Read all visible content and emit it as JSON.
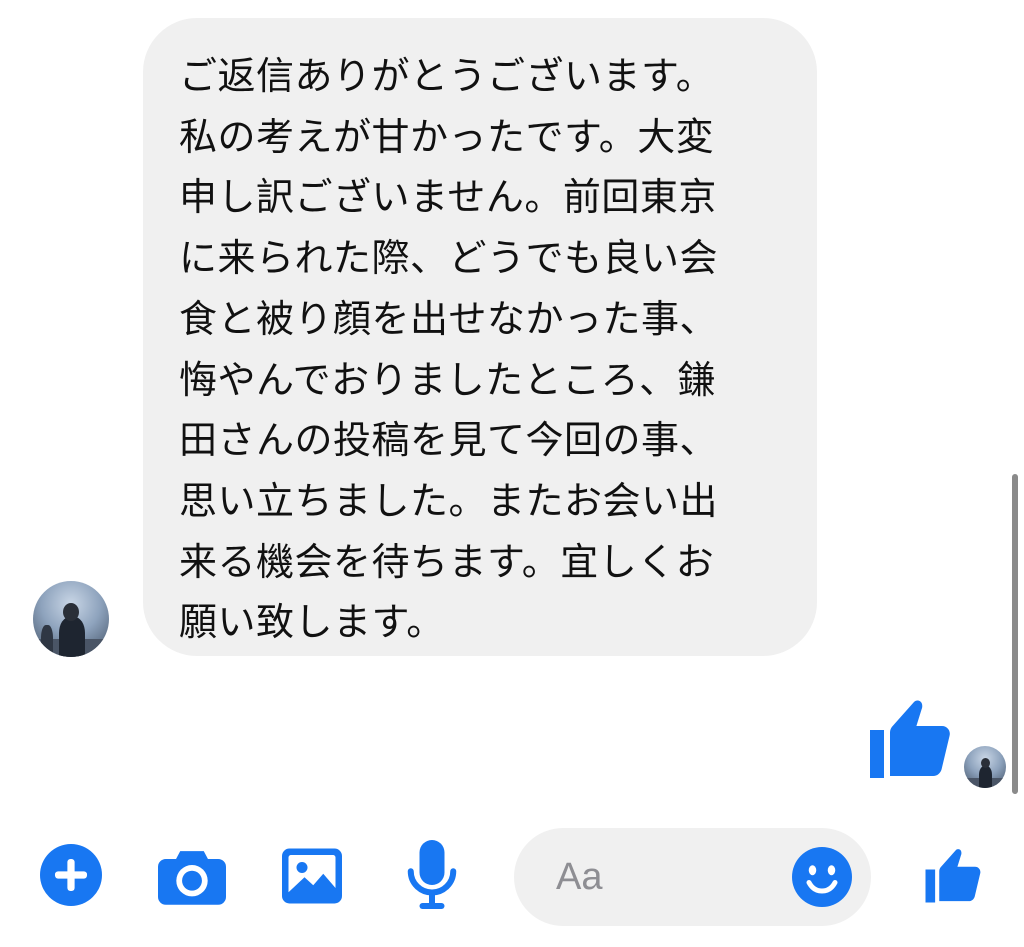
{
  "message": {
    "lines": [
      "ご返信ありがとうございます。",
      "私の考えが甘かったです。大変",
      "申し訳ございません。前回東京",
      "に来られた際、どうでも良い会",
      "食と被り顔を出せなかった事、",
      "悔やんでおりましたところ、鎌",
      "田さんの投稿を見て今回の事、",
      "思い立ちました。またお会い出",
      "来る機会を待ちます。宜しくお",
      "願い致します。"
    ]
  },
  "composer": {
    "placeholder": "Aa",
    "icons": [
      "plus-icon",
      "camera-icon",
      "image-icon",
      "microphone-icon",
      "emoji-icon",
      "thumbs-up-icon"
    ]
  },
  "colors": {
    "accent": "#1877f2",
    "bubble": "#f0f0f0",
    "text": "#111111",
    "placeholder": "#8e8e93"
  }
}
